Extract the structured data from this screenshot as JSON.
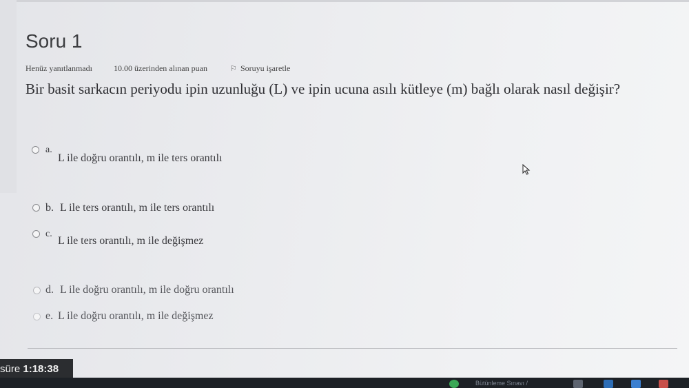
{
  "question": {
    "title": "Soru 1",
    "status": "Henüz yanıtlanmadı",
    "points": "10.00 üzerinden alınan puan",
    "flag_label": "Soruyu işaretle",
    "text": "Bir basit sarkacın periyodu ipin uzunluğu (L) ve ipin ucuna asılı kütleye (m) bağlı olarak nasıl değişir?"
  },
  "options": [
    {
      "letter": "a.",
      "text": "L ile doğru orantılı, m ile ters orantılı"
    },
    {
      "letter": "b.",
      "text": "L ile ters orantılı, m ile ters orantılı"
    },
    {
      "letter": "c.",
      "text": "L ile ters orantılı, m ile değişmez"
    },
    {
      "letter": "d.",
      "text": "L ile doğru orantılı, m ile doğru orantılı"
    },
    {
      "letter": "e.",
      "text": "L ile doğru orantılı, m ile değişmez"
    }
  ],
  "timer": {
    "label": "süre",
    "value": "1:18:38"
  },
  "taskbar": {
    "window_title": "Bütünleme Sınavı /"
  },
  "icons": [
    "flag-icon",
    "radio-icon",
    "cursor-icon",
    "chrome-icon",
    "media-icon",
    "word-icon"
  ]
}
